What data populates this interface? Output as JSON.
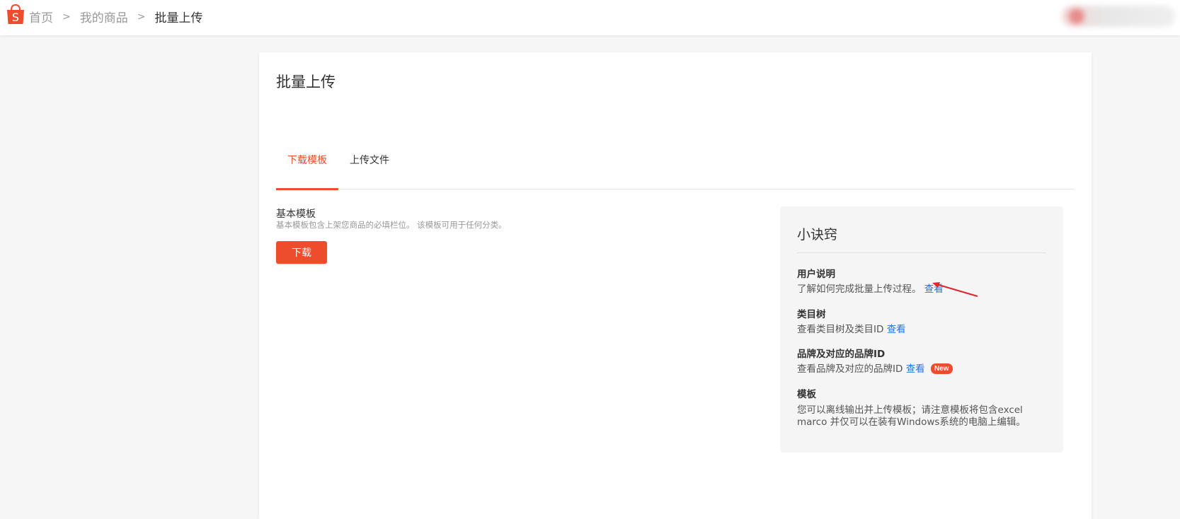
{
  "colors": {
    "brand": "#ee4d2d",
    "link": "#2673dd"
  },
  "header": {
    "logo_icon": "shopee-bag-icon",
    "logo_letter": "S",
    "breadcrumb": [
      "首页",
      "我的商品",
      "批量上传"
    ]
  },
  "page": {
    "title": "批量上传",
    "tabs": [
      {
        "label": "下载模板",
        "active": true
      },
      {
        "label": "上传文件",
        "active": false
      }
    ]
  },
  "template": {
    "title": "基本模板",
    "description": "基本模板包含上架您商品的必填栏位。 该模板可用于任何分类。",
    "download_label": "下载"
  },
  "tips": {
    "title": "小诀窍",
    "items": [
      {
        "heading": "用户说明",
        "text": "了解如何完成批量上传过程。",
        "link": "查看"
      },
      {
        "heading": "类目树",
        "text": "查看类目树及类目ID",
        "link": "查看"
      },
      {
        "heading": "品牌及对应的品牌ID",
        "text": "查看品牌及对应的品牌ID",
        "link": "查看",
        "badge": "New"
      },
      {
        "heading": "模板",
        "text_line1": "您可以离线输出并上传模板；请注意模板将包含excel",
        "text_line2": "marco 并仅可以在装有Windows系统的电脑上编辑。"
      }
    ]
  }
}
